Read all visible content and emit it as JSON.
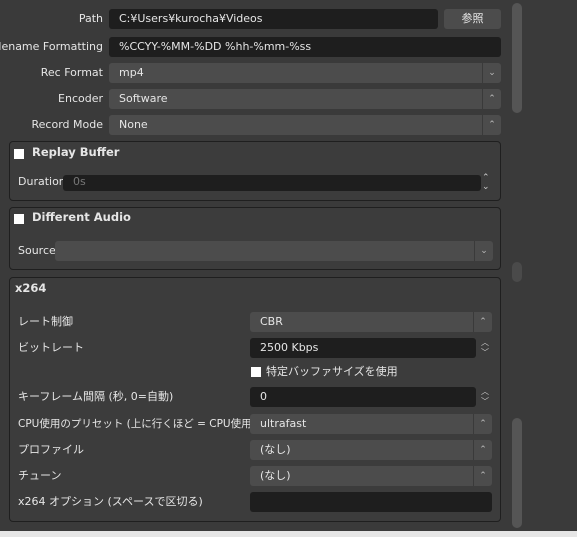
{
  "output": {
    "path": {
      "label": "Path",
      "value": "C:¥Users¥kurocha¥Videos",
      "browse": "参照"
    },
    "filename": {
      "label": "Filename Formatting",
      "value": "%CCYY-%MM-%DD %hh-%mm-%ss"
    },
    "rec_format": {
      "label": "Rec Format",
      "value": "mp4"
    },
    "encoder": {
      "label": "Encoder",
      "value": "Software"
    },
    "record_mode": {
      "label": "Record Mode",
      "value": "None"
    }
  },
  "replay_buffer": {
    "title": "Replay Buffer",
    "checked": false,
    "duration_label": "Duration",
    "duration_value": "0s"
  },
  "different_audio": {
    "title": "Different Audio",
    "checked": false,
    "source_label": "Source",
    "source_value": ""
  },
  "x264": {
    "title": "x264",
    "rate_control": {
      "label": "レート制御",
      "value": "CBR"
    },
    "bitrate": {
      "label": "ビットレート",
      "value": "2500 Kbps"
    },
    "buffer_checkbox": {
      "label": "特定バッファサイズを使用",
      "checked": false
    },
    "keyframe": {
      "label": "キーフレーム間隔 (秒, 0=自動)",
      "value": "0"
    },
    "preset": {
      "label": "CPU使用のプリセット (上に行くほど = CPU使用低い)",
      "value": "ultrafast"
    },
    "profile": {
      "label": "プロファイル",
      "value": "(なし)"
    },
    "tune": {
      "label": "チューン",
      "value": "(なし)"
    },
    "options": {
      "label": "x264 オプション (スペースで区切る)",
      "value": ""
    }
  }
}
